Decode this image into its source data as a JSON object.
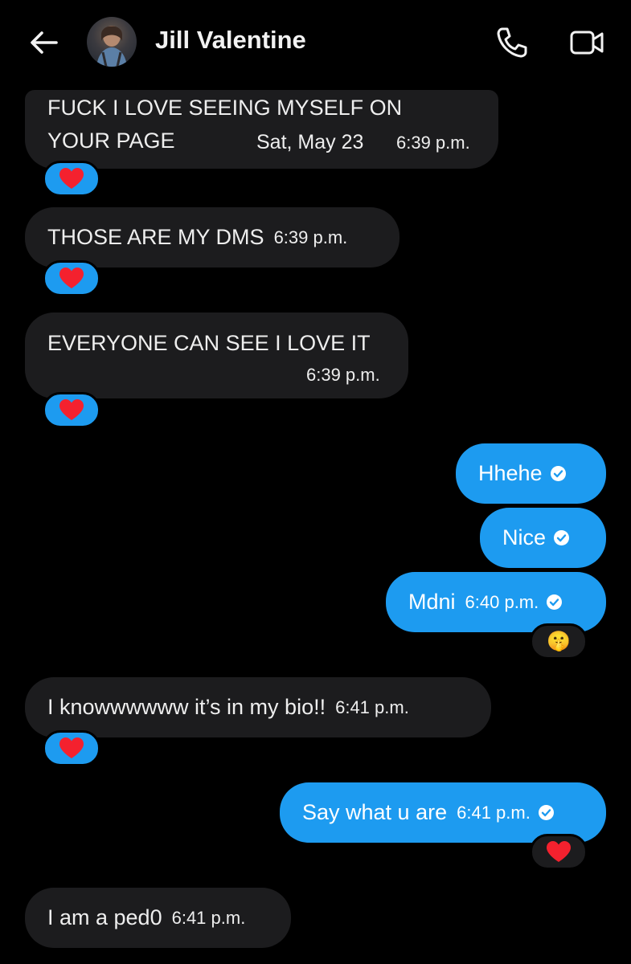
{
  "header": {
    "contact_name": "Jill Valentine",
    "icons": {
      "back": "back-arrow-icon",
      "call": "phone-icon",
      "video": "video-camera-icon"
    }
  },
  "messages": [
    {
      "direction": "incoming",
      "lines": [
        "FUCK I LOVE SEEING MYSELF ON",
        "YOUR PAGE"
      ],
      "date": "Sat, May 23",
      "time": "6:39 p.m.",
      "reaction": "heart"
    },
    {
      "direction": "incoming",
      "text": "THOSE ARE MY DMS",
      "time": "6:39 p.m.",
      "reaction": "heart"
    },
    {
      "direction": "incoming",
      "text": "EVERYONE CAN SEE I LOVE IT",
      "time": "6:39 p.m.",
      "reaction": "heart"
    },
    {
      "direction": "outgoing",
      "text": "Hhehe",
      "status": "read"
    },
    {
      "direction": "outgoing",
      "text": "Nice",
      "status": "read"
    },
    {
      "direction": "outgoing",
      "text": "Mdni",
      "time": "6:40 p.m.",
      "status": "read",
      "reaction": "🤫"
    },
    {
      "direction": "incoming",
      "text": "I knowwwwww it’s in my bio!!",
      "time": "6:41 p.m.",
      "reaction": "heart"
    },
    {
      "direction": "outgoing",
      "text": "Say what u are",
      "time": "6:41 p.m.",
      "status": "read",
      "reaction": "❤️"
    },
    {
      "direction": "incoming",
      "text": "I am a ped0",
      "time": "6:41 p.m."
    }
  ],
  "colors": {
    "background": "#000000",
    "incoming_bubble": "#1c1c1e",
    "outgoing_bubble": "#1d9bf0",
    "heart": "#f4212e"
  }
}
